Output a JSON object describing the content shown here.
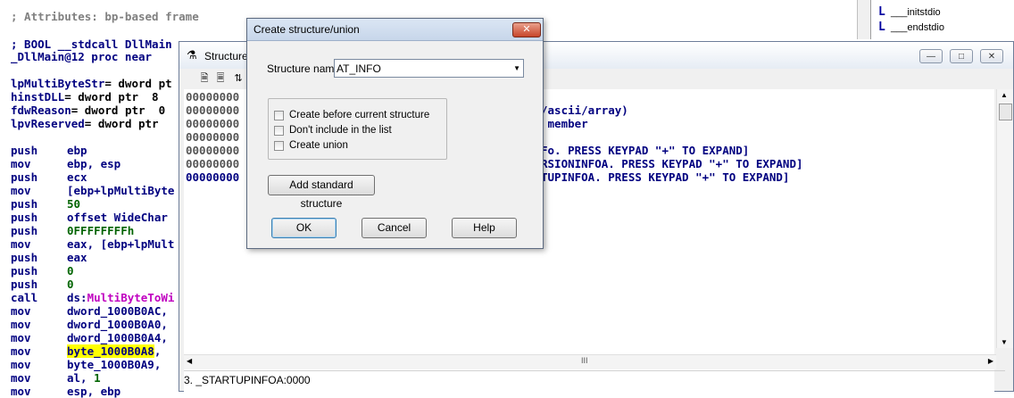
{
  "disasm": {
    "comment": "; Attributes: bp-based frame",
    "proto": "; BOOL __stdcall DllMain",
    "proc": "_DllMain@12 proc near",
    "args": [
      {
        "name": "lpMultiByteStr",
        "rest": "= dword pt"
      },
      {
        "name": "hinstDLL",
        "rest": "= dword ptr  8"
      },
      {
        "name": "fdwReason",
        "rest": "= dword ptr  0"
      },
      {
        "name": "lpvReserved",
        "rest": "= dword ptr"
      }
    ],
    "code": [
      {
        "op": "push",
        "a": "ebp"
      },
      {
        "op": "mov",
        "a": "ebp, esp"
      },
      {
        "op": "push",
        "a": "ecx"
      },
      {
        "op": "mov",
        "a": "[ebp+",
        "b": "lpMultiByte"
      },
      {
        "op": "push",
        "g": "50"
      },
      {
        "op": "push",
        "a": "offset WideChar"
      },
      {
        "op": "push",
        "g": "0FFFFFFFFh"
      },
      {
        "op": "mov",
        "a": "eax, [ebp+",
        "b": "lpMult"
      },
      {
        "op": "push",
        "a": "eax"
      },
      {
        "op": "push",
        "g": "0"
      },
      {
        "op": "push",
        "g": "0"
      },
      {
        "op": "call",
        "a": "ds:",
        "m": "MultiByteToWi"
      },
      {
        "op": "mov",
        "a": "dword_1000B0AC,"
      },
      {
        "op": "mov",
        "a": "dword_1000B0A0,"
      },
      {
        "op": "mov",
        "a": "dword_1000B0A4,"
      },
      {
        "op": "mov",
        "h": "byte_1000B0A8",
        "a2": ","
      },
      {
        "op": "mov",
        "a": "byte_1000B0A9,"
      },
      {
        "op": "mov",
        "a": "al, ",
        "g": "1"
      },
      {
        "op": "mov",
        "a": "esp, ebp"
      }
    ]
  },
  "funcs": {
    "items": [
      {
        "icon": "L",
        "label": "___initstdio"
      },
      {
        "icon": "L",
        "label": "___endstdio"
      }
    ]
  },
  "structwin": {
    "title": "Structure",
    "lines": [
      "00000000",
      "00000000",
      "00000000",
      "00000000",
      "00000000",
      "00000000",
      "00000000"
    ],
    "right": [
      "/ascii/array)",
      " member",
      "",
      "Fo. PRESS KEYPAD \"+\" TO EXPAND]",
      "RSIONINFOA. PRESS KEYPAD \"+\" TO EXPAND]",
      "TUPINFOA. PRESS KEYPAD \"+\" TO EXPAND]"
    ],
    "scroll_grip": "III",
    "status": "3. _STARTUPINFOA:0000"
  },
  "dialog": {
    "title": "Create structure/union",
    "name_label": "Structure name",
    "name_value": "AT_INFO",
    "checkboxes": [
      "Create before current structure",
      "Don't include in the list",
      "Create union"
    ],
    "std_button": "Add standard structure",
    "ok": "OK",
    "cancel": "Cancel",
    "help": "Help"
  }
}
